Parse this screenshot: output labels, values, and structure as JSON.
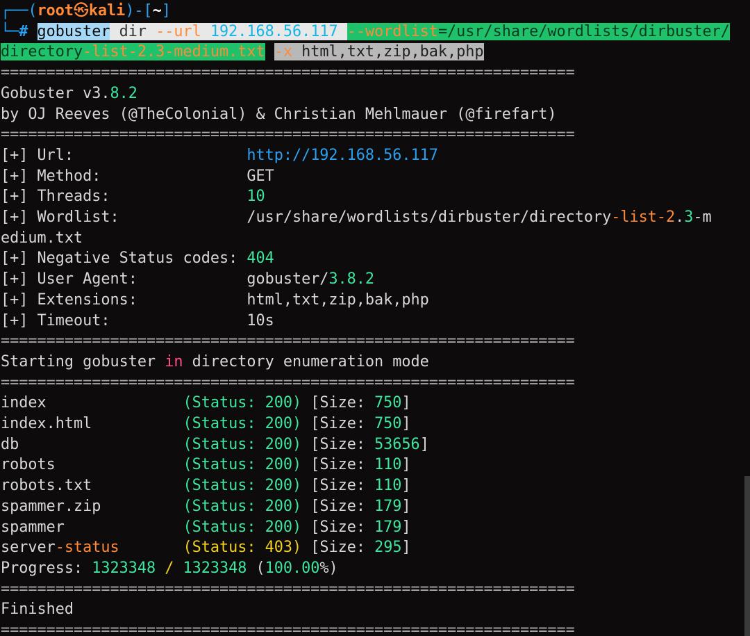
{
  "prompt": {
    "frame_open": "┌──(",
    "user": "root",
    "skull": "㉿",
    "host": "kali",
    "frame_mid": ")-[",
    "path": "~",
    "frame_close": "]",
    "corner": "└─",
    "hash": "#"
  },
  "command": {
    "segments": [
      {
        "text": "gobuster",
        "style": "hl-cmd"
      },
      {
        "text": " dir ",
        "style": "hl-white"
      },
      {
        "text": "--url",
        "style": "hl-opt"
      },
      {
        "text": " 192.168.56.117 ",
        "style": "hl-ip"
      },
      {
        "text": "--wordlist",
        "style": "hl-green-o"
      },
      {
        "text": "=/usr/share/wordlists/dirbuster/",
        "style": "hl-green"
      }
    ],
    "segments_line2": [
      {
        "text": "directory",
        "style": "hl-green"
      },
      {
        "text": "-list-2.3-medium.txt",
        "style": "hl-green-o"
      },
      {
        "text": " ",
        "style": "c-default"
      },
      {
        "text": "-x",
        "style": "hl-grey-o"
      },
      {
        "text": " html,txt,zip,bak,php",
        "style": "hl-grey"
      }
    ]
  },
  "rule": "===============================================================",
  "lines": [
    [
      {
        "text": "Gobuster v3.",
        "color": "c-default"
      },
      {
        "text": "8.2",
        "color": "c-green"
      }
    ],
    [
      {
        "text": "by OJ Reeves (@TheColonial) & Christian Mehlmauer (@firefart)",
        "color": "c-default"
      }
    ],
    "RULE",
    [
      {
        "text": "[+] Url:                   ",
        "color": "c-default"
      },
      {
        "text": "http://192.168.56.117",
        "color": "c-blue"
      }
    ],
    [
      {
        "text": "[+] Method:                ",
        "color": "c-default"
      },
      {
        "text": "GET",
        "color": "c-default"
      }
    ],
    [
      {
        "text": "[+] Threads:               ",
        "color": "c-default"
      },
      {
        "text": "10",
        "color": "c-green"
      }
    ],
    [
      {
        "text": "[+] Wordlist:              ",
        "color": "c-default"
      },
      {
        "text": "/usr/share/wordlists/dirbuster/directory",
        "color": "c-default"
      },
      {
        "text": "-list-",
        "color": "c-orange"
      },
      {
        "text": "2",
        "color": "c-orange"
      },
      {
        "text": ".",
        "color": "c-default"
      },
      {
        "text": "3",
        "color": "c-green"
      },
      {
        "text": "-m",
        "color": "c-default"
      }
    ],
    [
      {
        "text": "edium.txt",
        "color": "c-default"
      }
    ],
    [
      {
        "text": "[+] Negative Status codes: ",
        "color": "c-default"
      },
      {
        "text": "404",
        "color": "c-green"
      }
    ],
    [
      {
        "text": "[+] User Agent:            ",
        "color": "c-default"
      },
      {
        "text": "gobuster/",
        "color": "c-default"
      },
      {
        "text": "3.8.2",
        "color": "c-green"
      }
    ],
    [
      {
        "text": "[+] Extensions:            ",
        "color": "c-default"
      },
      {
        "text": "html,txt,zip,bak,php",
        "color": "c-default"
      }
    ],
    [
      {
        "text": "[+] Timeout:               ",
        "color": "c-default"
      },
      {
        "text": "10s",
        "color": "c-default"
      }
    ],
    "RULE",
    [
      {
        "text": "Starting gobuster ",
        "color": "c-default"
      },
      {
        "text": "in",
        "color": "c-pink"
      },
      {
        "text": " directory enumeration mode",
        "color": "c-default"
      }
    ],
    "RULE",
    [
      {
        "text": "index               ",
        "color": "c-default"
      },
      {
        "text": "(Status: ",
        "color": "c-green"
      },
      {
        "text": "200",
        "color": "c-green"
      },
      {
        "text": ")",
        "color": "c-green"
      },
      {
        "text": " [Size: ",
        "color": "c-default"
      },
      {
        "text": "750",
        "color": "c-green"
      },
      {
        "text": "]",
        "color": "c-default"
      }
    ],
    [
      {
        "text": "index.html          ",
        "color": "c-default"
      },
      {
        "text": "(Status: ",
        "color": "c-green"
      },
      {
        "text": "200",
        "color": "c-green"
      },
      {
        "text": ")",
        "color": "c-green"
      },
      {
        "text": " [Size: ",
        "color": "c-default"
      },
      {
        "text": "750",
        "color": "c-green"
      },
      {
        "text": "]",
        "color": "c-default"
      }
    ],
    [
      {
        "text": "db                  ",
        "color": "c-default"
      },
      {
        "text": "(Status: ",
        "color": "c-green"
      },
      {
        "text": "200",
        "color": "c-green"
      },
      {
        "text": ")",
        "color": "c-green"
      },
      {
        "text": " [Size: ",
        "color": "c-default"
      },
      {
        "text": "53656",
        "color": "c-green"
      },
      {
        "text": "]",
        "color": "c-default"
      }
    ],
    [
      {
        "text": "robots              ",
        "color": "c-default"
      },
      {
        "text": "(Status: ",
        "color": "c-green"
      },
      {
        "text": "200",
        "color": "c-green"
      },
      {
        "text": ")",
        "color": "c-green"
      },
      {
        "text": " [Size: ",
        "color": "c-default"
      },
      {
        "text": "110",
        "color": "c-green"
      },
      {
        "text": "]",
        "color": "c-default"
      }
    ],
    [
      {
        "text": "robots.txt          ",
        "color": "c-default"
      },
      {
        "text": "(Status: ",
        "color": "c-green"
      },
      {
        "text": "200",
        "color": "c-green"
      },
      {
        "text": ")",
        "color": "c-green"
      },
      {
        "text": " [Size: ",
        "color": "c-default"
      },
      {
        "text": "110",
        "color": "c-green"
      },
      {
        "text": "]",
        "color": "c-default"
      }
    ],
    [
      {
        "text": "spammer.zip         ",
        "color": "c-default"
      },
      {
        "text": "(Status: ",
        "color": "c-green"
      },
      {
        "text": "200",
        "color": "c-green"
      },
      {
        "text": ")",
        "color": "c-green"
      },
      {
        "text": " [Size: ",
        "color": "c-default"
      },
      {
        "text": "179",
        "color": "c-green"
      },
      {
        "text": "]",
        "color": "c-default"
      }
    ],
    [
      {
        "text": "spammer             ",
        "color": "c-default"
      },
      {
        "text": "(Status: ",
        "color": "c-green"
      },
      {
        "text": "200",
        "color": "c-green"
      },
      {
        "text": ")",
        "color": "c-green"
      },
      {
        "text": " [Size: ",
        "color": "c-default"
      },
      {
        "text": "179",
        "color": "c-green"
      },
      {
        "text": "]",
        "color": "c-default"
      }
    ],
    [
      {
        "text": "server",
        "color": "c-default"
      },
      {
        "text": "-status       ",
        "color": "c-orange"
      },
      {
        "text": "(Status: ",
        "color": "c-yellow"
      },
      {
        "text": "403",
        "color": "c-yellow"
      },
      {
        "text": ")",
        "color": "c-yellow"
      },
      {
        "text": " [Size: ",
        "color": "c-default"
      },
      {
        "text": "295",
        "color": "c-green"
      },
      {
        "text": "]",
        "color": "c-default"
      }
    ],
    [
      {
        "text": "Progress: ",
        "color": "c-default"
      },
      {
        "text": "1323348",
        "color": "c-green"
      },
      {
        "text": " / ",
        "color": "c-yellow"
      },
      {
        "text": "1323348",
        "color": "c-green"
      },
      {
        "text": " (",
        "color": "c-default"
      },
      {
        "text": "100.00",
        "color": "c-green"
      },
      {
        "text": "%)",
        "color": "c-default"
      }
    ],
    "RULE",
    [
      {
        "text": "Finished",
        "color": "c-default"
      }
    ],
    "RULE"
  ]
}
